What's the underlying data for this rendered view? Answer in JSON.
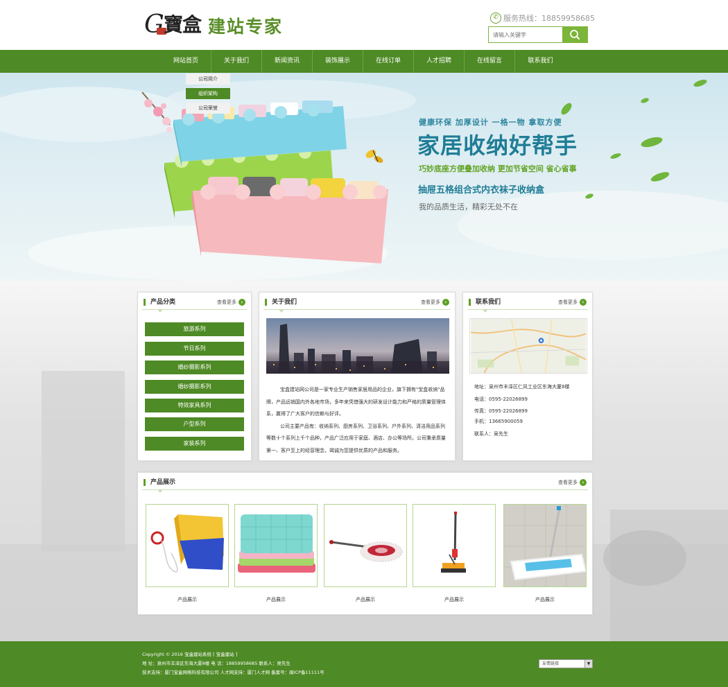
{
  "header": {
    "logo_letter": "G",
    "logo_mark": "寶盒",
    "logo_name": "建站专家",
    "hotline": "服务热线：18859958685",
    "search_placeholder": "请输入关键字"
  },
  "nav": {
    "items": [
      "网站首页",
      "关于我们",
      "新闻资讯",
      "装饰展示",
      "在线订单",
      "人才招聘",
      "在线留言",
      "联系我们"
    ],
    "submenu": [
      "公司简介",
      "组织架构",
      "公司荣誉"
    ],
    "submenu_active_index": 1
  },
  "banner": {
    "line1": "健康环保  加厚设计  一格一物  拿取方便",
    "line2": "家居收纳好帮手",
    "line3": "巧妙底座方便叠加收纳  更加节省空间  省心省事",
    "line4": "抽屉五格组合式内衣袜子收纳盒",
    "line5": "我的品质生活，精彩无处不在"
  },
  "categories": {
    "title": "产品分类",
    "more": "查看更多",
    "items": [
      "旅游系列",
      "节日系列",
      "婚纱摄影系列",
      "婚纱摄影系列",
      "特效家具系列",
      "户型系列",
      "家装系列"
    ]
  },
  "about": {
    "title": "关于我们",
    "more": "查看更多",
    "paragraphs": [
      "宝盒建站网公司是一家专业生产销售家居用品的企业，旗下拥有\"宝盒收纳\"品牌，产品远销国内外各地市场，多年来凭借强大的研发设计能力和严格的质量管理体系，赢得了广大客户的信赖与好评。",
      "公司主要产品有：收纳系列、厨房系列、卫浴系列、户外系列、清洁用品系列等数十个系列上千个品种，产品广泛应用于家庭、酒店、办公等场所。公司秉承质量第一、客户至上的经营理念，竭诚为您提供优质的产品和服务。"
    ]
  },
  "contact": {
    "title": "联系我们",
    "more": "查看更多",
    "rows": [
      "地址：泉州市丰泽区仁风工业区东海大厦8楼",
      "电话：0595-22026899",
      "传真：0595-22026899",
      "手机：13665900059",
      "联系人：吴先生"
    ]
  },
  "products": {
    "title": "产品展示",
    "more": "查看更多",
    "items": [
      {
        "caption": "产品展示",
        "icon": "window-cleaner-icon"
      },
      {
        "caption": "产品展示",
        "icon": "towels-icon"
      },
      {
        "caption": "产品展示",
        "icon": "dust-mop-icon"
      },
      {
        "caption": "产品展示",
        "icon": "sponge-mop-icon"
      },
      {
        "caption": "产品展示",
        "icon": "flat-mop-icon"
      }
    ]
  },
  "footer": {
    "line1": "Copyright © 2016 宝盒建站系统 [ 宝盒建站 ]",
    "line2": "地  址：泉州市丰泽区东海大厦8楼  电  话：18859958685  联系人：吴先生",
    "line3": "技术支持：厦门宝盒网络科技有限公司  人才网支持：厦门人才网  备案号：闽ICP备11111号",
    "links_label": "友情链接"
  },
  "colors": {
    "brand_green": "#4e8a25",
    "accent_green": "#7bb53a",
    "banner_blue": "#1f7d96"
  }
}
